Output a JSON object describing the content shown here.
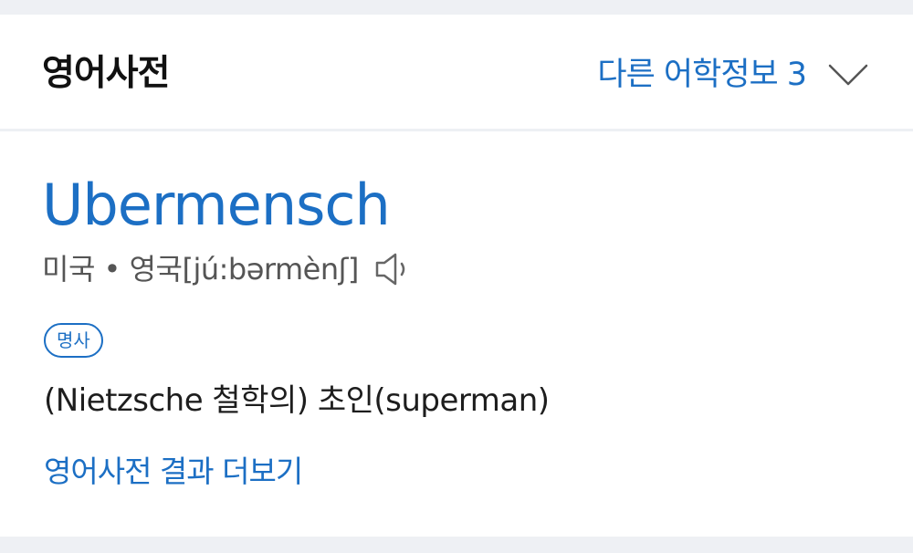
{
  "header": {
    "section_title": "영어사전",
    "other_info_label": "다른 어학정보",
    "other_info_count": "3",
    "chevron_icon": "chevron-down-icon"
  },
  "entry": {
    "headword": "Ubermensch",
    "pronunciation": "미국 • 영국[jú:bərmènʃ]",
    "speaker_icon": "speaker-icon",
    "pos": "명사",
    "definition": "(Nietzsche 철학의) 초인(superman)",
    "more_link": "영어사전 결과 더보기"
  },
  "colors": {
    "accent": "#1c6fc4",
    "text": "#111111",
    "muted": "#555555",
    "background": "#eef0f4",
    "card": "#ffffff"
  }
}
